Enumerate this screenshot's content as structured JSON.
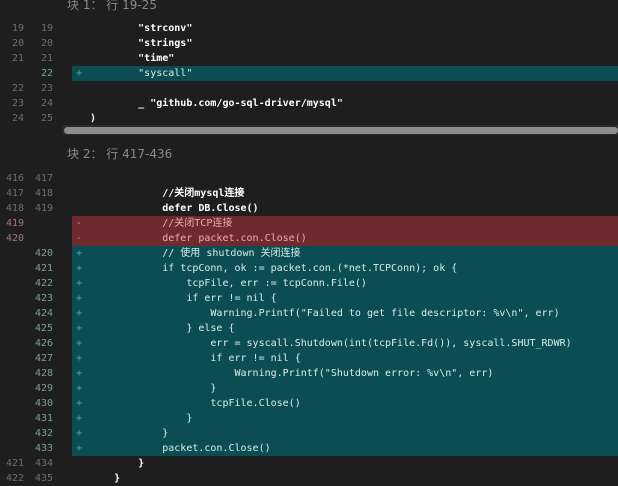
{
  "hunks": [
    {
      "title": "块 1： 行 19-25",
      "lines": [
        {
          "old": "19",
          "new": "19",
          "sign": "",
          "type": "ctx",
          "code": "        \"strconv\""
        },
        {
          "old": "20",
          "new": "20",
          "sign": "",
          "type": "ctx",
          "code": "        \"strings\""
        },
        {
          "old": "21",
          "new": "21",
          "sign": "",
          "type": "ctx",
          "code": "        \"time\""
        },
        {
          "old": "",
          "new": "22",
          "sign": "+",
          "type": "add",
          "code": "        \"syscall\""
        },
        {
          "old": "22",
          "new": "23",
          "sign": "",
          "type": "ctx",
          "code": ""
        },
        {
          "old": "23",
          "new": "24",
          "sign": "",
          "type": "ctx",
          "code": "        _ \"github.com/go-sql-driver/mysql\""
        },
        {
          "old": "24",
          "new": "25",
          "sign": "",
          "type": "ctx",
          "code": ")"
        }
      ]
    },
    {
      "title": "块 2： 行 417-436",
      "lines": [
        {
          "old": "416",
          "new": "417",
          "sign": "",
          "type": "ctx",
          "code": ""
        },
        {
          "old": "417",
          "new": "418",
          "sign": "",
          "type": "ctx",
          "code": "            //关闭mysql连接"
        },
        {
          "old": "418",
          "new": "419",
          "sign": "",
          "type": "ctx",
          "code": "            defer DB.Close()"
        },
        {
          "old": "419",
          "new": "",
          "sign": "-",
          "type": "del",
          "code": "            //关闭TCP连接"
        },
        {
          "old": "420",
          "new": "",
          "sign": "-",
          "type": "del",
          "code": "            defer packet.con.Close()"
        },
        {
          "old": "",
          "new": "420",
          "sign": "+",
          "type": "add",
          "code": "            // 使用 shutdown 关闭连接"
        },
        {
          "old": "",
          "new": "421",
          "sign": "+",
          "type": "add",
          "code": "            if tcpConn, ok := packet.con.(*net.TCPConn); ok {"
        },
        {
          "old": "",
          "new": "422",
          "sign": "+",
          "type": "add",
          "code": "                tcpFile, err := tcpConn.File()"
        },
        {
          "old": "",
          "new": "423",
          "sign": "+",
          "type": "add",
          "code": "                if err != nil {"
        },
        {
          "old": "",
          "new": "424",
          "sign": "+",
          "type": "add",
          "code": "                    Warning.Printf(\"Failed to get file descriptor: %v\\n\", err)"
        },
        {
          "old": "",
          "new": "425",
          "sign": "+",
          "type": "add",
          "code": "                } else {"
        },
        {
          "old": "",
          "new": "426",
          "sign": "+",
          "type": "add",
          "code": "                    err = syscall.Shutdown(int(tcpFile.Fd()), syscall.SHUT_RDWR)"
        },
        {
          "old": "",
          "new": "427",
          "sign": "+",
          "type": "add",
          "code": "                    if err != nil {"
        },
        {
          "old": "",
          "new": "428",
          "sign": "+",
          "type": "add",
          "code": "                        Warning.Printf(\"Shutdown error: %v\\n\", err)"
        },
        {
          "old": "",
          "new": "429",
          "sign": "+",
          "type": "add",
          "code": "                    }"
        },
        {
          "old": "",
          "new": "430",
          "sign": "+",
          "type": "add",
          "code": "                    tcpFile.Close()"
        },
        {
          "old": "",
          "new": "431",
          "sign": "+",
          "type": "add",
          "code": "                }"
        },
        {
          "old": "",
          "new": "432",
          "sign": "+",
          "type": "add",
          "code": "            }"
        },
        {
          "old": "",
          "new": "433",
          "sign": "+",
          "type": "add",
          "code": "            packet.con.Close()"
        },
        {
          "old": "421",
          "new": "434",
          "sign": "",
          "type": "ctx",
          "code": "        }"
        },
        {
          "old": "422",
          "new": "435",
          "sign": "",
          "type": "ctx",
          "code": "    }"
        }
      ]
    }
  ],
  "colors": {
    "background": "#1e1e1e",
    "added": "#0b4d52",
    "deleted": "#6f2a30"
  }
}
